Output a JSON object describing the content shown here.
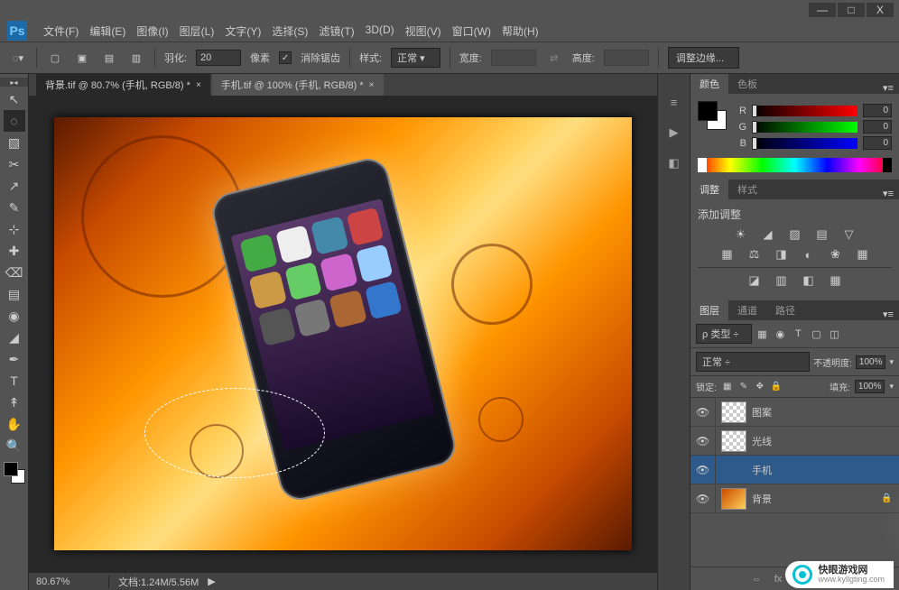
{
  "app": {
    "logo": "Ps"
  },
  "win_buttons": {
    "min": "—",
    "max": "□",
    "close": "X"
  },
  "menu": [
    "文件(F)",
    "编辑(E)",
    "图像(I)",
    "图层(L)",
    "文字(Y)",
    "选择(S)",
    "滤镜(T)",
    "3D(D)",
    "视图(V)",
    "窗口(W)",
    "帮助(H)"
  ],
  "options": {
    "feather_label": "羽化:",
    "feather_value": "20",
    "feather_unit": "像素",
    "antialias_check": "✓",
    "antialias_label": "消除锯齿",
    "style_label": "样式:",
    "style_value": "正常",
    "width_label": "宽度:",
    "swap_icon": "⇄",
    "height_label": "高度:",
    "refine_btn": "调整边缘..."
  },
  "tabs": [
    {
      "label": "背景.tif @ 80.7% (手机, RGB/8) *",
      "active": true
    },
    {
      "label": "手机.tif @ 100% (手机, RGB/8) *",
      "active": false
    }
  ],
  "tools": [
    "↖",
    "◌",
    "▧",
    "✂",
    "↗",
    "✎",
    "⊹",
    "✚",
    "⌫",
    "▤",
    "◉",
    "◢",
    "✒",
    "T",
    "↟",
    "✋",
    "🔍"
  ],
  "status": {
    "zoom": "80.67%",
    "docinfo": "文档:1.24M/5.56M",
    "arrow": "▶"
  },
  "mini_icons": [
    "≡",
    "▶",
    "◧"
  ],
  "color_panel": {
    "tab_color": "颜色",
    "tab_swatch": "色板",
    "fg": "#000000",
    "bg": "#ffffff",
    "r_label": "R",
    "r_val": "0",
    "g_label": "G",
    "g_val": "0",
    "b_label": "B",
    "b_val": "0"
  },
  "adjust_panel": {
    "tab_adjust": "调整",
    "tab_style": "样式",
    "title": "添加调整",
    "row1": [
      "☀",
      "◢",
      "▨",
      "▤",
      "▽"
    ],
    "row2": [
      "▦",
      "⚖",
      "◨",
      "◐",
      "❀",
      "▦"
    ],
    "row3": [
      "◪",
      "▥",
      "◧",
      "▦"
    ]
  },
  "layers_panel": {
    "tab_layers": "图层",
    "tab_channels": "通道",
    "tab_paths": "路径",
    "filter_label": "ρ 类型",
    "filter_icons": [
      "▦",
      "◉",
      "T",
      "▢",
      "◫"
    ],
    "blend_mode": "正常",
    "opacity_label": "不透明度:",
    "opacity_value": "100%",
    "lock_label": "锁定:",
    "lock_icons": [
      "▦",
      "✎",
      "✥",
      "🔒"
    ],
    "fill_label": "填充:",
    "fill_value": "100%",
    "layers": [
      {
        "name": "图案",
        "visible": true,
        "thumb": "checker",
        "selected": false,
        "locked": false
      },
      {
        "name": "光线",
        "visible": true,
        "thumb": "checker",
        "selected": false,
        "locked": false
      },
      {
        "name": "手机",
        "visible": true,
        "thumb": "phone",
        "selected": true,
        "locked": false
      },
      {
        "name": "背景",
        "visible": true,
        "thumb": "bg",
        "selected": false,
        "locked": true
      }
    ],
    "footer_icons": [
      "⇔",
      "fx",
      "◐",
      "◪",
      "▢",
      "▣",
      "🗑"
    ]
  },
  "watermark": {
    "line1": "快眼游戏网",
    "line2": "www.kyllgting.com"
  }
}
